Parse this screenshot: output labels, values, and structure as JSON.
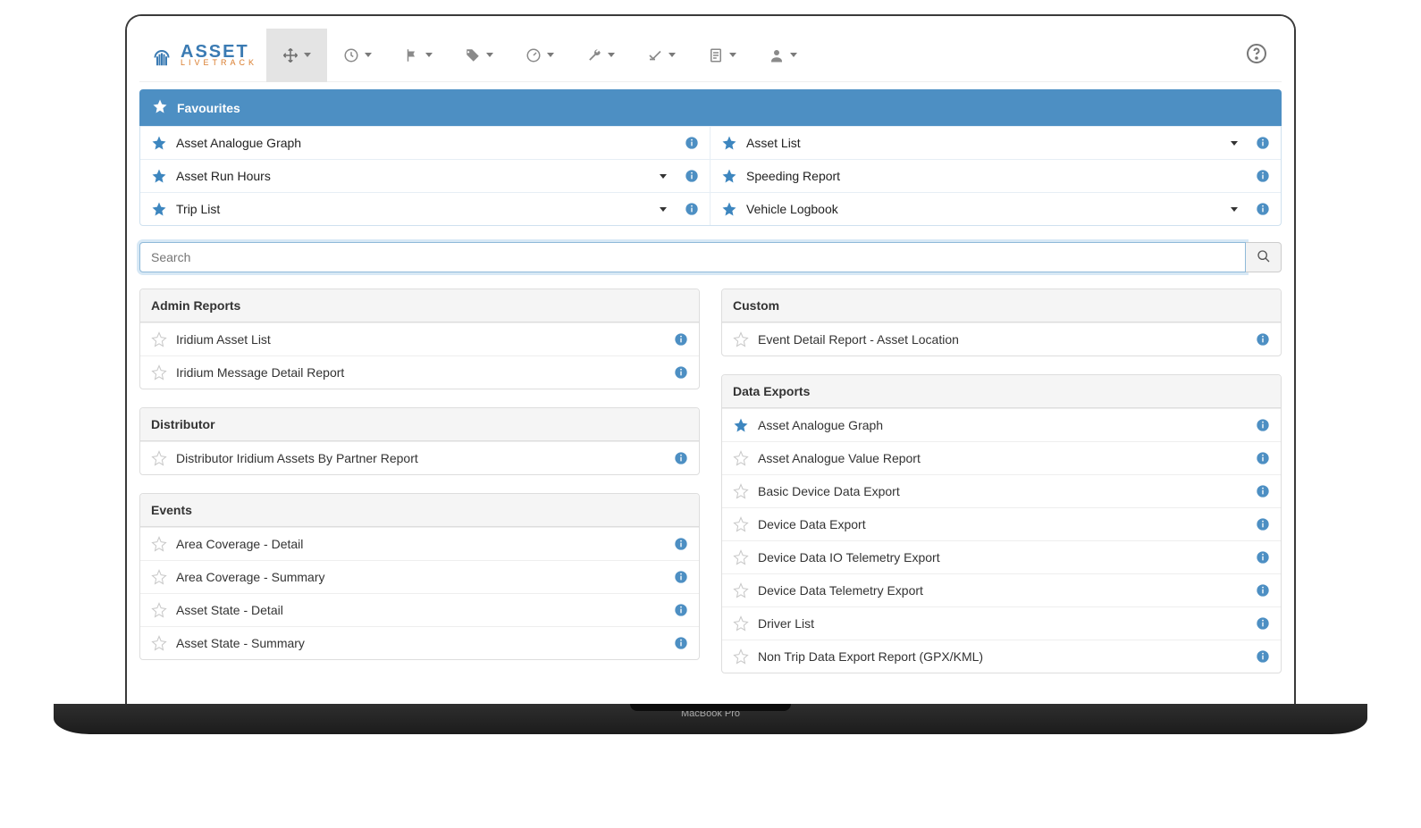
{
  "brand": {
    "line1": "ASSET",
    "line2": "LIVETRACK"
  },
  "search": {
    "placeholder": "Search"
  },
  "favourites": {
    "title": "Favourites",
    "items": [
      {
        "label": "Asset Analogue Graph",
        "dropdown": false
      },
      {
        "label": "Asset List",
        "dropdown": true
      },
      {
        "label": "Asset Run Hours",
        "dropdown": true
      },
      {
        "label": "Speeding Report",
        "dropdown": false
      },
      {
        "label": "Trip List",
        "dropdown": true
      },
      {
        "label": "Vehicle Logbook",
        "dropdown": true
      }
    ]
  },
  "left": [
    {
      "title": "Admin Reports",
      "rows": [
        {
          "label": "Iridium Asset List",
          "starred": false
        },
        {
          "label": "Iridium Message Detail Report",
          "starred": false
        }
      ]
    },
    {
      "title": "Distributor",
      "rows": [
        {
          "label": "Distributor Iridium Assets By Partner Report",
          "starred": false
        }
      ]
    },
    {
      "title": "Events",
      "rows": [
        {
          "label": "Area Coverage - Detail",
          "starred": false
        },
        {
          "label": "Area Coverage - Summary",
          "starred": false
        },
        {
          "label": "Asset State - Detail",
          "starred": false
        },
        {
          "label": "Asset State - Summary",
          "starred": false
        }
      ]
    }
  ],
  "right": [
    {
      "title": "Custom",
      "rows": [
        {
          "label": "Event Detail Report - Asset Location",
          "starred": false
        }
      ]
    },
    {
      "title": "Data Exports",
      "rows": [
        {
          "label": "Asset Analogue Graph",
          "starred": true
        },
        {
          "label": "Asset Analogue Value Report",
          "starred": false
        },
        {
          "label": "Basic Device Data Export",
          "starred": false
        },
        {
          "label": "Device Data Export",
          "starred": false
        },
        {
          "label": "Device Data IO Telemetry Export",
          "starred": false
        },
        {
          "label": "Device Data Telemetry Export",
          "starred": false
        },
        {
          "label": "Driver List",
          "starred": false
        },
        {
          "label": "Non Trip Data Export Report (GPX/KML)",
          "starred": false
        }
      ]
    }
  ]
}
